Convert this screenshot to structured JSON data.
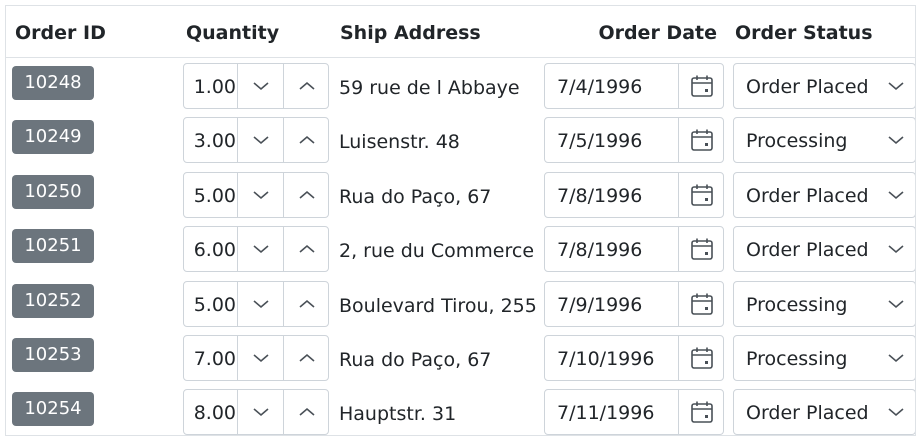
{
  "columns": {
    "order_id": "Order ID",
    "quantity": "Quantity",
    "ship_address": "Ship Address",
    "order_date": "Order Date",
    "order_status": "Order Status"
  },
  "rows": [
    {
      "order_id": "10248",
      "quantity": "1.00",
      "ship_address": "59 rue de l Abbaye",
      "order_date": "7/4/1996",
      "order_status": "Order Placed"
    },
    {
      "order_id": "10249",
      "quantity": "3.00",
      "ship_address": "Luisenstr. 48",
      "order_date": "7/5/1996",
      "order_status": "Processing"
    },
    {
      "order_id": "10250",
      "quantity": "5.00",
      "ship_address": "Rua do Paço, 67",
      "order_date": "7/8/1996",
      "order_status": "Order Placed"
    },
    {
      "order_id": "10251",
      "quantity": "6.00",
      "ship_address": "2, rue du Commerce",
      "order_date": "7/8/1996",
      "order_status": "Order Placed"
    },
    {
      "order_id": "10252",
      "quantity": "5.00",
      "ship_address": "Boulevard Tirou, 255",
      "order_date": "7/9/1996",
      "order_status": "Processing"
    },
    {
      "order_id": "10253",
      "quantity": "7.00",
      "ship_address": "Rua do Paço, 67",
      "order_date": "7/10/1996",
      "order_status": "Processing"
    },
    {
      "order_id": "10254",
      "quantity": "8.00",
      "ship_address": "Hauptstr. 31",
      "order_date": "7/11/1996",
      "order_status": "Order Placed"
    }
  ],
  "icons": {
    "spin_down": "chevron-down-icon",
    "spin_up": "chevron-up-icon",
    "calendar": "calendar-icon",
    "dropdown": "chevron-down-icon"
  },
  "colors": {
    "badge_bg": "#6c757d",
    "badge_text": "#ffffff",
    "border": "#ced4da"
  }
}
